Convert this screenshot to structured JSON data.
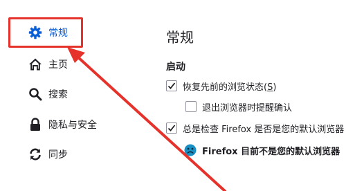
{
  "sidebar": {
    "items": [
      {
        "label": "常规",
        "icon": "gear-icon",
        "selected": true
      },
      {
        "label": "主页",
        "icon": "home-icon",
        "selected": false
      },
      {
        "label": "搜索",
        "icon": "search-icon",
        "selected": false
      },
      {
        "label": "隐私与安全",
        "icon": "lock-icon",
        "selected": false
      },
      {
        "label": "同步",
        "icon": "sync-icon",
        "selected": false
      }
    ]
  },
  "main": {
    "title": "常规",
    "startup": {
      "heading": "启动",
      "restore_session": {
        "label": "恢复先前的浏览状态(",
        "accesskey": "S",
        "suffix": ")",
        "checked": true
      },
      "warn_on_quit": {
        "label": "退出浏览器时提醒确认",
        "checked": false
      },
      "check_default": {
        "label": "总是检查 Firefox 是否是您的默认浏览器",
        "checked": true
      },
      "default_status": "Firefox 目前不是您的默认浏览器"
    }
  },
  "colors": {
    "accent": "#0a5fd6",
    "annotation": "#e5322b",
    "checkmark": "#1f1f24"
  }
}
